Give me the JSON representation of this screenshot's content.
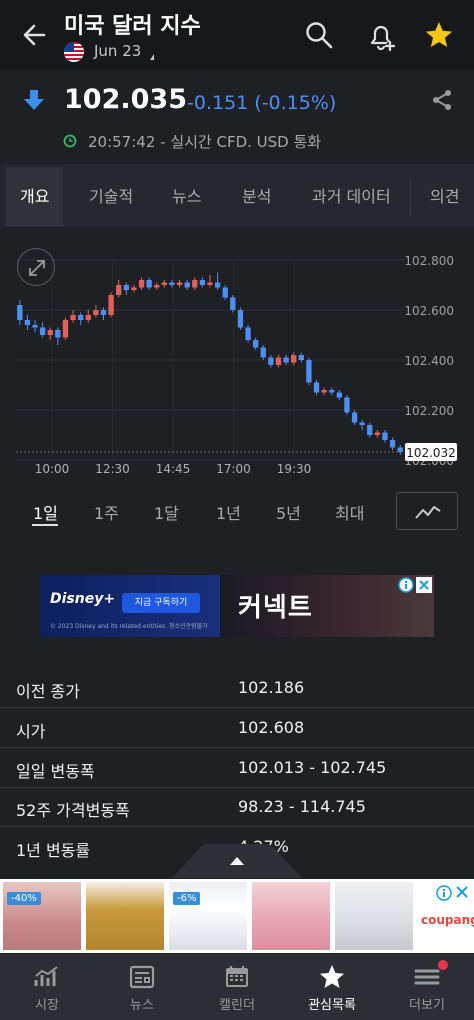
{
  "header": {
    "title": "미국 달러 지수",
    "date": "Jun 23",
    "icons": [
      "back-icon",
      "us-flag-icon",
      "search-icon",
      "add-alert-icon",
      "star-icon"
    ]
  },
  "quote": {
    "price": "102.035",
    "change": "-0.151 (-0.15%)",
    "time_info": "20:57:42 - 실시간 CFD. USD 통화",
    "colors": {
      "down": "#4e8ef7",
      "up": "#e2605a"
    }
  },
  "tabs": [
    {
      "label": "개요",
      "active": true
    },
    {
      "label": "기술적"
    },
    {
      "label": "뉴스"
    },
    {
      "label": "분석"
    },
    {
      "label": "과거 데이터"
    },
    {
      "label": "의견"
    }
  ],
  "chart_data": {
    "type": "candlestick",
    "y_ticks": [
      "102.800",
      "102.600",
      "102.400",
      "102.200",
      "102.000"
    ],
    "x_ticks": [
      "10:00",
      "12:30",
      "14:45",
      "17:00",
      "19:30"
    ],
    "ylim": [
      102.0,
      102.8
    ],
    "current_price_label": "102.032",
    "candles": [
      {
        "o": 102.62,
        "c": 102.56,
        "h": 102.64,
        "l": 102.54
      },
      {
        "o": 102.56,
        "c": 102.54,
        "h": 102.58,
        "l": 102.52
      },
      {
        "o": 102.54,
        "c": 102.53,
        "h": 102.56,
        "l": 102.51
      },
      {
        "o": 102.53,
        "c": 102.5,
        "h": 102.55,
        "l": 102.49
      },
      {
        "o": 102.5,
        "c": 102.52,
        "h": 102.53,
        "l": 102.48
      },
      {
        "o": 102.52,
        "c": 102.49,
        "h": 102.53,
        "l": 102.46
      },
      {
        "o": 102.49,
        "c": 102.56,
        "h": 102.57,
        "l": 102.48
      },
      {
        "o": 102.56,
        "c": 102.58,
        "h": 102.6,
        "l": 102.55
      },
      {
        "o": 102.58,
        "c": 102.56,
        "h": 102.59,
        "l": 102.54
      },
      {
        "o": 102.56,
        "c": 102.58,
        "h": 102.6,
        "l": 102.55
      },
      {
        "o": 102.58,
        "c": 102.6,
        "h": 102.62,
        "l": 102.57
      },
      {
        "o": 102.6,
        "c": 102.58,
        "h": 102.61,
        "l": 102.56
      },
      {
        "o": 102.58,
        "c": 102.66,
        "h": 102.67,
        "l": 102.57
      },
      {
        "o": 102.66,
        "c": 102.7,
        "h": 102.72,
        "l": 102.65
      },
      {
        "o": 102.7,
        "c": 102.68,
        "h": 102.71,
        "l": 102.66
      },
      {
        "o": 102.68,
        "c": 102.69,
        "h": 102.7,
        "l": 102.67
      },
      {
        "o": 102.69,
        "c": 102.72,
        "h": 102.73,
        "l": 102.68
      },
      {
        "o": 102.72,
        "c": 102.69,
        "h": 102.73,
        "l": 102.68
      },
      {
        "o": 102.69,
        "c": 102.7,
        "h": 102.71,
        "l": 102.68
      },
      {
        "o": 102.7,
        "c": 102.71,
        "h": 102.72,
        "l": 102.69
      },
      {
        "o": 102.71,
        "c": 102.7,
        "h": 102.72,
        "l": 102.69
      },
      {
        "o": 102.7,
        "c": 102.71,
        "h": 102.72,
        "l": 102.69
      },
      {
        "o": 102.71,
        "c": 102.69,
        "h": 102.72,
        "l": 102.68
      },
      {
        "o": 102.69,
        "c": 102.72,
        "h": 102.73,
        "l": 102.68
      },
      {
        "o": 102.72,
        "c": 102.7,
        "h": 102.73,
        "l": 102.69
      },
      {
        "o": 102.7,
        "c": 102.71,
        "h": 102.74,
        "l": 102.69
      },
      {
        "o": 102.71,
        "c": 102.69,
        "h": 102.75,
        "l": 102.68
      },
      {
        "o": 102.69,
        "c": 102.65,
        "h": 102.7,
        "l": 102.64
      },
      {
        "o": 102.65,
        "c": 102.6,
        "h": 102.66,
        "l": 102.59
      },
      {
        "o": 102.6,
        "c": 102.53,
        "h": 102.61,
        "l": 102.52
      },
      {
        "o": 102.53,
        "c": 102.48,
        "h": 102.54,
        "l": 102.47
      },
      {
        "o": 102.48,
        "c": 102.45,
        "h": 102.49,
        "l": 102.44
      },
      {
        "o": 102.45,
        "c": 102.41,
        "h": 102.46,
        "l": 102.4
      },
      {
        "o": 102.41,
        "c": 102.38,
        "h": 102.42,
        "l": 102.37
      },
      {
        "o": 102.38,
        "c": 102.41,
        "h": 102.42,
        "l": 102.37
      },
      {
        "o": 102.41,
        "c": 102.39,
        "h": 102.42,
        "l": 102.38
      },
      {
        "o": 102.39,
        "c": 102.42,
        "h": 102.43,
        "l": 102.38
      },
      {
        "o": 102.42,
        "c": 102.4,
        "h": 102.43,
        "l": 102.39
      },
      {
        "o": 102.4,
        "c": 102.31,
        "h": 102.41,
        "l": 102.3
      },
      {
        "o": 102.31,
        "c": 102.27,
        "h": 102.32,
        "l": 102.26
      },
      {
        "o": 102.27,
        "c": 102.28,
        "h": 102.29,
        "l": 102.26
      },
      {
        "o": 102.28,
        "c": 102.27,
        "h": 102.29,
        "l": 102.26
      },
      {
        "o": 102.27,
        "c": 102.25,
        "h": 102.28,
        "l": 102.24
      },
      {
        "o": 102.25,
        "c": 102.19,
        "h": 102.26,
        "l": 102.18
      },
      {
        "o": 102.19,
        "c": 102.15,
        "h": 102.2,
        "l": 102.14
      },
      {
        "o": 102.15,
        "c": 102.14,
        "h": 102.16,
        "l": 102.12
      },
      {
        "o": 102.14,
        "c": 102.1,
        "h": 102.15,
        "l": 102.09
      },
      {
        "o": 102.1,
        "c": 102.11,
        "h": 102.12,
        "l": 102.09
      },
      {
        "o": 102.11,
        "c": 102.08,
        "h": 102.12,
        "l": 102.07
      },
      {
        "o": 102.08,
        "c": 102.05,
        "h": 102.09,
        "l": 102.04
      },
      {
        "o": 102.05,
        "c": 102.032,
        "h": 102.06,
        "l": 102.02
      }
    ]
  },
  "ranges": [
    {
      "label": "1일",
      "active": true
    },
    {
      "label": "1주"
    },
    {
      "label": "1달"
    },
    {
      "label": "1년"
    },
    {
      "label": "5년"
    },
    {
      "label": "최대"
    }
  ],
  "ad_banner": {
    "brand": "Disney+",
    "cta": "지금 구독하기",
    "fine_print": "© 2023 Disney and its related entities. 청소년관람불가",
    "title": "커넥트"
  },
  "stats": [
    {
      "label": "이전 종가",
      "value": "102.186"
    },
    {
      "label": "시가",
      "value": "102.608"
    },
    {
      "label": "일일 변동폭",
      "value": "102.013 - 102.745"
    },
    {
      "label": "52주 가격변동폭",
      "value": "98.23 - 114.745"
    },
    {
      "label": "1년 변동률",
      "value": "4.27%"
    }
  ],
  "product_ad": {
    "brand": "coupang",
    "badges": [
      "-40%",
      "-6%"
    ]
  },
  "bottom_nav": [
    {
      "label": "시장",
      "icon": "markets-icon"
    },
    {
      "label": "뉴스",
      "icon": "news-icon"
    },
    {
      "label": "캘린더",
      "icon": "calendar-icon"
    },
    {
      "label": "관심목록",
      "icon": "watchlist-star-icon",
      "active": true
    },
    {
      "label": "더보기",
      "icon": "more-icon"
    }
  ]
}
